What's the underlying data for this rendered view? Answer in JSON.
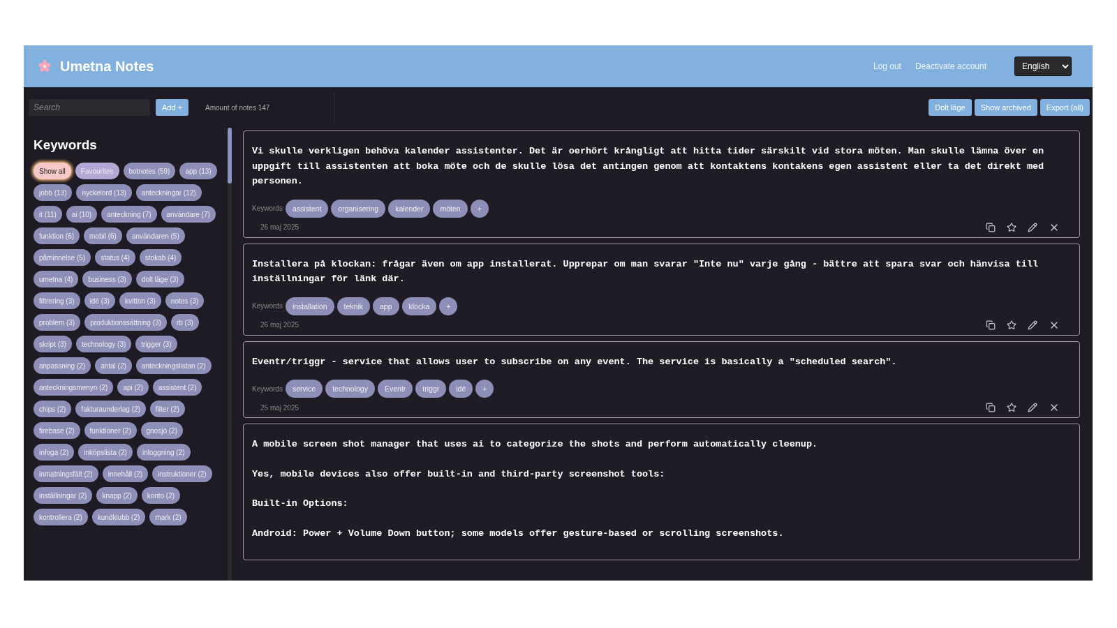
{
  "header": {
    "title": "Umetna Notes",
    "links": [
      "Log out",
      "Deactivate account"
    ],
    "language": "English"
  },
  "toolbar": {
    "search": {
      "placeholder": "Search"
    },
    "add_button": "Add +",
    "count": "Amount of notes 147",
    "buttons": [
      "Dolt läge",
      "Show archived",
      "Export (all)"
    ]
  },
  "sidebar": {
    "title": "Keywords",
    "filters": [
      {
        "label": "Show all",
        "kind": "all",
        "selected": true
      },
      {
        "label": "Favourites",
        "kind": "favourites",
        "selected": false
      },
      {
        "label": "botnotes (59)",
        "kind": "keyword",
        "selected": false
      },
      {
        "label": "app (13)",
        "kind": "keyword",
        "selected": false
      },
      {
        "label": "jobb (13)",
        "kind": "keyword",
        "selected": false
      },
      {
        "label": "nyckelord (13)",
        "kind": "keyword",
        "selected": false
      },
      {
        "label": "anteckningar (12)",
        "kind": "keyword",
        "selected": false
      },
      {
        "label": "it (11)",
        "kind": "keyword",
        "selected": false
      },
      {
        "label": "ai (10)",
        "kind": "keyword",
        "selected": false
      },
      {
        "label": "anteckning (7)",
        "kind": "keyword",
        "selected": false
      },
      {
        "label": "användare (7)",
        "kind": "keyword",
        "selected": false
      },
      {
        "label": "funktion (6)",
        "kind": "keyword",
        "selected": false
      },
      {
        "label": "mobil (6)",
        "kind": "keyword",
        "selected": false
      },
      {
        "label": "användaren (5)",
        "kind": "keyword",
        "selected": false
      },
      {
        "label": "påminnelse (5)",
        "kind": "keyword",
        "selected": false
      },
      {
        "label": "status (4)",
        "kind": "keyword",
        "selected": false
      },
      {
        "label": "stokab (4)",
        "kind": "keyword",
        "selected": false
      },
      {
        "label": "umetna (4)",
        "kind": "keyword",
        "selected": false
      },
      {
        "label": "business (3)",
        "kind": "keyword",
        "selected": false
      },
      {
        "label": "dolt läge (3)",
        "kind": "keyword",
        "selected": false
      },
      {
        "label": "filtrering (3)",
        "kind": "keyword",
        "selected": false
      },
      {
        "label": "idé (3)",
        "kind": "keyword",
        "selected": false
      },
      {
        "label": "kvitton (3)",
        "kind": "keyword",
        "selected": false
      },
      {
        "label": "notes (3)",
        "kind": "keyword",
        "selected": false
      },
      {
        "label": "problem (3)",
        "kind": "keyword",
        "selected": false
      },
      {
        "label": "produktionssättning (3)",
        "kind": "keyword",
        "selected": false
      },
      {
        "label": "rb (3)",
        "kind": "keyword",
        "selected": false
      },
      {
        "label": "skript (3)",
        "kind": "keyword",
        "selected": false
      },
      {
        "label": "technology (3)",
        "kind": "keyword",
        "selected": false
      },
      {
        "label": "trigger (3)",
        "kind": "keyword",
        "selected": false
      },
      {
        "label": "anpassning (2)",
        "kind": "keyword",
        "selected": false
      },
      {
        "label": "antal (2)",
        "kind": "keyword",
        "selected": false
      },
      {
        "label": "anteckningslistan (2)",
        "kind": "keyword",
        "selected": false
      },
      {
        "label": "anteckningsmenyn (2)",
        "kind": "keyword",
        "selected": false
      },
      {
        "label": "api (2)",
        "kind": "keyword",
        "selected": false
      },
      {
        "label": "assistent (2)",
        "kind": "keyword",
        "selected": false
      },
      {
        "label": "chips (2)",
        "kind": "keyword",
        "selected": false
      },
      {
        "label": "fakturaunderlag (2)",
        "kind": "keyword",
        "selected": false
      },
      {
        "label": "filter (2)",
        "kind": "keyword",
        "selected": false
      },
      {
        "label": "firebase (2)",
        "kind": "keyword",
        "selected": false
      },
      {
        "label": "funktioner (2)",
        "kind": "keyword",
        "selected": false
      },
      {
        "label": "gnosjö (2)",
        "kind": "keyword",
        "selected": false
      },
      {
        "label": "infoga (2)",
        "kind": "keyword",
        "selected": false
      },
      {
        "label": "inköpslista (2)",
        "kind": "keyword",
        "selected": false
      },
      {
        "label": "inloggning (2)",
        "kind": "keyword",
        "selected": false
      },
      {
        "label": "inmatningsfält (2)",
        "kind": "keyword",
        "selected": false
      },
      {
        "label": "innehåll (2)",
        "kind": "keyword",
        "selected": false
      },
      {
        "label": "instruktioner (2)",
        "kind": "keyword",
        "selected": false
      },
      {
        "label": "inställningar (2)",
        "kind": "keyword",
        "selected": false
      },
      {
        "label": "knapp (2)",
        "kind": "keyword",
        "selected": false
      },
      {
        "label": "konto (2)",
        "kind": "keyword",
        "selected": false
      },
      {
        "label": "kontrollera (2)",
        "kind": "keyword",
        "selected": false
      },
      {
        "label": "kundklubb (2)",
        "kind": "keyword",
        "selected": false
      },
      {
        "label": "mark (2)",
        "kind": "keyword",
        "selected": false
      }
    ]
  },
  "notes": [
    {
      "paragraphs": [
        "Vi skulle verkligen behöva kalender assistenter. Det är oerhört krångligt att hitta tider särskilt vid stora möten. Man skulle lämna över en uppgift till assistenten att boka möte och de skulle lösa det antingen genom att kontaktens kontakens egen assistent eller ta det direkt med personen."
      ],
      "keywords_label": "Keywords",
      "keywords": [
        "assistent",
        "organisering",
        "kalender",
        "möten"
      ],
      "add": "+",
      "date": "26 maj 2025"
    },
    {
      "paragraphs": [
        "Installera på klockan: frågar även om app installerat. Upprepar om man svarar \"Inte nu\" varje gång - bättre att spara svar och hänvisa till inställningar för länk där."
      ],
      "keywords_label": "Keywords",
      "keywords": [
        "installation",
        "teknik",
        "app",
        "klocka"
      ],
      "add": "+",
      "date": "26 maj 2025"
    },
    {
      "paragraphs": [
        "Eventr/triggr - service that allows user to subscribe on any event. The service is basically a \"scheduled search\"."
      ],
      "keywords_label": "Keywords",
      "keywords": [
        "service",
        "technology",
        "Eventr",
        "triggr",
        "idé"
      ],
      "add": "+",
      "date": "25 maj 2025"
    },
    {
      "paragraphs": [
        "A mobile screen shot manager that uses ai to categorize the shots and perform automatically cleenup.",
        "Yes, mobile devices also offer built-in and third-party screenshot tools:",
        "Built-in Options:",
        "Android: Power + Volume Down button; some models offer gesture-based or scrolling screenshots."
      ]
    }
  ]
}
